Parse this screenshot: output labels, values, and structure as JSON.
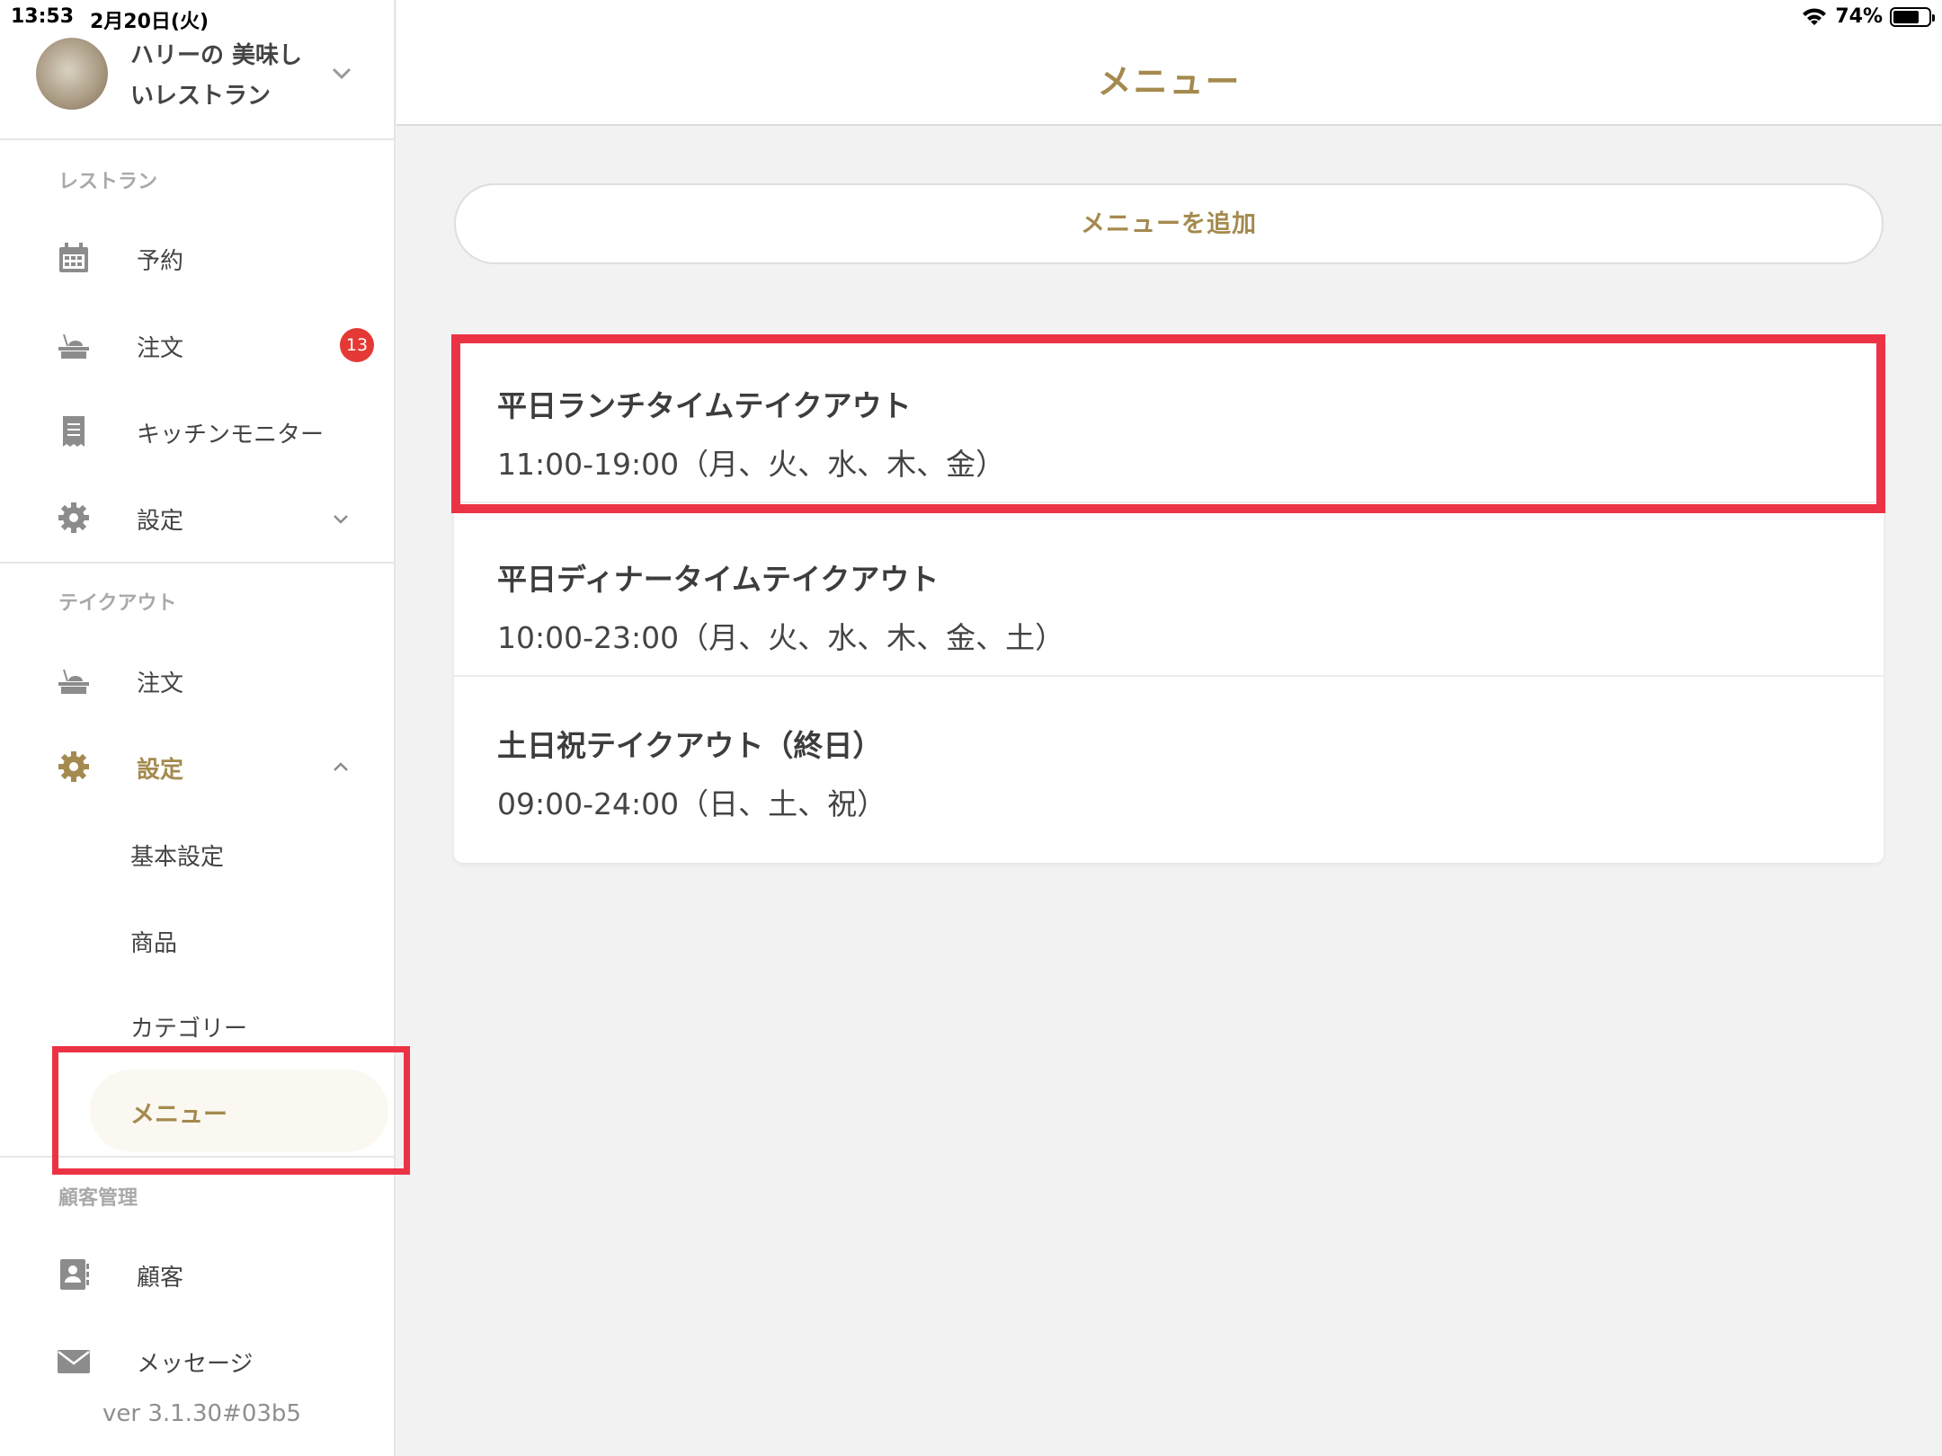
{
  "status": {
    "time": "13:53",
    "date": "2月20日(火)",
    "battery": "74%",
    "battery_fraction": 0.74
  },
  "profile": {
    "name": "ハリーの 美味しいレストラン"
  },
  "sidebar": {
    "restaurant": {
      "label": "レストラン",
      "items": [
        {
          "label": "予約"
        },
        {
          "label": "注文",
          "badge": "13"
        },
        {
          "label": "キッチンモニター"
        },
        {
          "label": "設定"
        }
      ]
    },
    "takeout": {
      "label": "テイクアウト",
      "items": [
        {
          "label": "注文"
        },
        {
          "label": "設定"
        }
      ],
      "sub_items": [
        "基本設定",
        "商品",
        "カテゴリー",
        "メニュー"
      ]
    },
    "customers": {
      "label": "顧客管理",
      "items": [
        {
          "label": "顧客"
        },
        {
          "label": "メッセージ"
        }
      ]
    },
    "version": "ver 3.1.30#03b5"
  },
  "main": {
    "title": "メニュー",
    "add_button": "メニューを追加",
    "menus": [
      {
        "name": "平日ランチタイムテイクアウト",
        "hours": "11:00-19:00（月、火、水、木、金）"
      },
      {
        "name": "平日ディナータイムテイクアウト",
        "hours": "10:00-23:00（月、火、水、木、金、土）"
      },
      {
        "name": "土日祝テイクアウト（終日）",
        "hours": "09:00-24:00（日、土、祝）"
      }
    ]
  },
  "colors": {
    "accent": "#a48a4e",
    "highlight_red": "#ec3345",
    "badge_red": "#e53935"
  }
}
